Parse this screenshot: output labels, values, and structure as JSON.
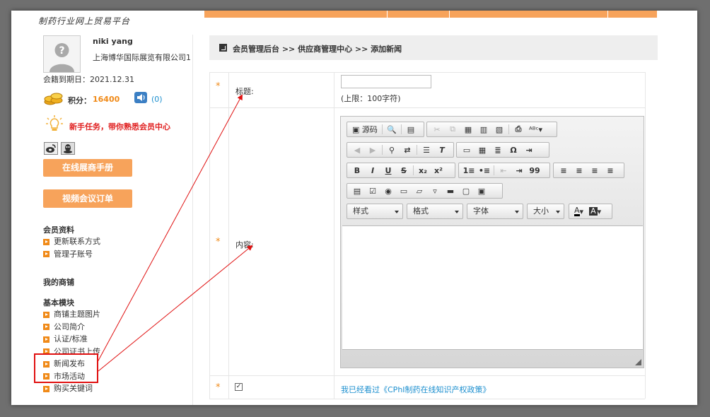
{
  "site_logo": "制药行业网上贸易平台",
  "user": {
    "name": "niki yang",
    "company": "上海博华国际展览有限公司1",
    "expiry_label": "会籍到期日：2021.12.31",
    "points_label": "积分：",
    "points_value": "16400",
    "message_count": "(0)",
    "task_text": "新手任务，带你熟悉会员中心"
  },
  "buttons": {
    "manual": "在线展商手册",
    "video": "视频会议订单"
  },
  "sidebar": {
    "profile_title": "会员资料",
    "profile_items": [
      "更新联系方式",
      "管理子账号"
    ],
    "shop_title": "我的商铺",
    "basic_title": "基本模块",
    "basic_items": [
      "商铺主题图片",
      "公司简介",
      "认证/标准",
      "公司证书上传",
      "新闻发布",
      "市场活动",
      "购买关键词"
    ]
  },
  "breadcrumb": "会员管理后台 >> 供应商管理中心 >> 添加新闻",
  "form": {
    "required_mark": "*",
    "title_label": "标题:",
    "title_value": "",
    "title_hint": "(上限：100字符)",
    "content_label": "内容:",
    "agree_checked": true,
    "agree_text": "我已经看过《CPhI制药在线知识产权政策》"
  },
  "editor": {
    "source_label": "源码",
    "styles_label": "样式",
    "format_label": "格式",
    "font_label": "字体",
    "size_label": "大小",
    "toolbar_row3": [
      "B",
      "I",
      "U",
      "S",
      "x₂",
      "x²",
      "1≡",
      "•≡",
      "⇤",
      "⇥",
      "99",
      "≡",
      "≡",
      "≡",
      "≡"
    ],
    "toolbar_row1_icons": [
      "preview-icon",
      "template-icon",
      "cut-icon",
      "copy-icon",
      "paste-icon",
      "paste-text-icon",
      "paste-word-icon",
      "print-icon",
      "spellcheck-icon"
    ],
    "toolbar_row2_icons": [
      "undo-icon",
      "redo-icon",
      "find-icon",
      "replace-icon",
      "select-all-icon",
      "remove-format-icon",
      "image-icon",
      "table-icon",
      "horizontal-rule-icon",
      "special-char-icon",
      "page-break-icon"
    ],
    "toolbar_row4_icons": [
      "form-icon",
      "checkbox-icon",
      "radio-icon",
      "textfield-icon",
      "textarea-icon",
      "select-icon",
      "button-icon",
      "image-button-icon",
      "hidden-field-icon"
    ],
    "text_color_label": "A",
    "bg_color_label": "A"
  }
}
